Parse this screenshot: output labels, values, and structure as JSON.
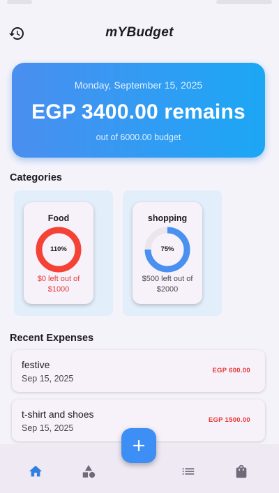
{
  "app": {
    "title": "mYBudget"
  },
  "summary": {
    "date": "Monday, September 15, 2025",
    "remaining": "EGP 3400.00 remains",
    "budget_text": "out of 6000.00 budget"
  },
  "categories_section": {
    "title": "Categories",
    "items": [
      {
        "name": "Food",
        "percent_label": "110%",
        "progress": 1.0,
        "left_text": "$0 left out of $1000",
        "ring_color": "#f44336",
        "text_color": "#e53935"
      },
      {
        "name": "shopping",
        "percent_label": "75%",
        "progress": 0.75,
        "left_text": "$500 left out of $2000",
        "ring_color": "#4a90f0",
        "text_color": "#49454f"
      }
    ]
  },
  "expenses_section": {
    "title": "Recent Expenses",
    "items": [
      {
        "name": "festive",
        "date": "Sep 15, 2025",
        "amount": "EGP 600.00"
      },
      {
        "name": "t-shirt and shoes",
        "date": "Sep 15, 2025",
        "amount": "EGP 1500.00"
      }
    ]
  },
  "icons": {
    "history": "history-icon",
    "add": "add-icon",
    "nav": [
      "home-icon",
      "category-icon",
      "list-icon",
      "shopping-bag-icon"
    ]
  },
  "colors": {
    "accent": "#3d8ff5",
    "nav_active": "#2f7fe0",
    "nav_inactive": "#6f6a78",
    "over_budget": "#e53935"
  }
}
